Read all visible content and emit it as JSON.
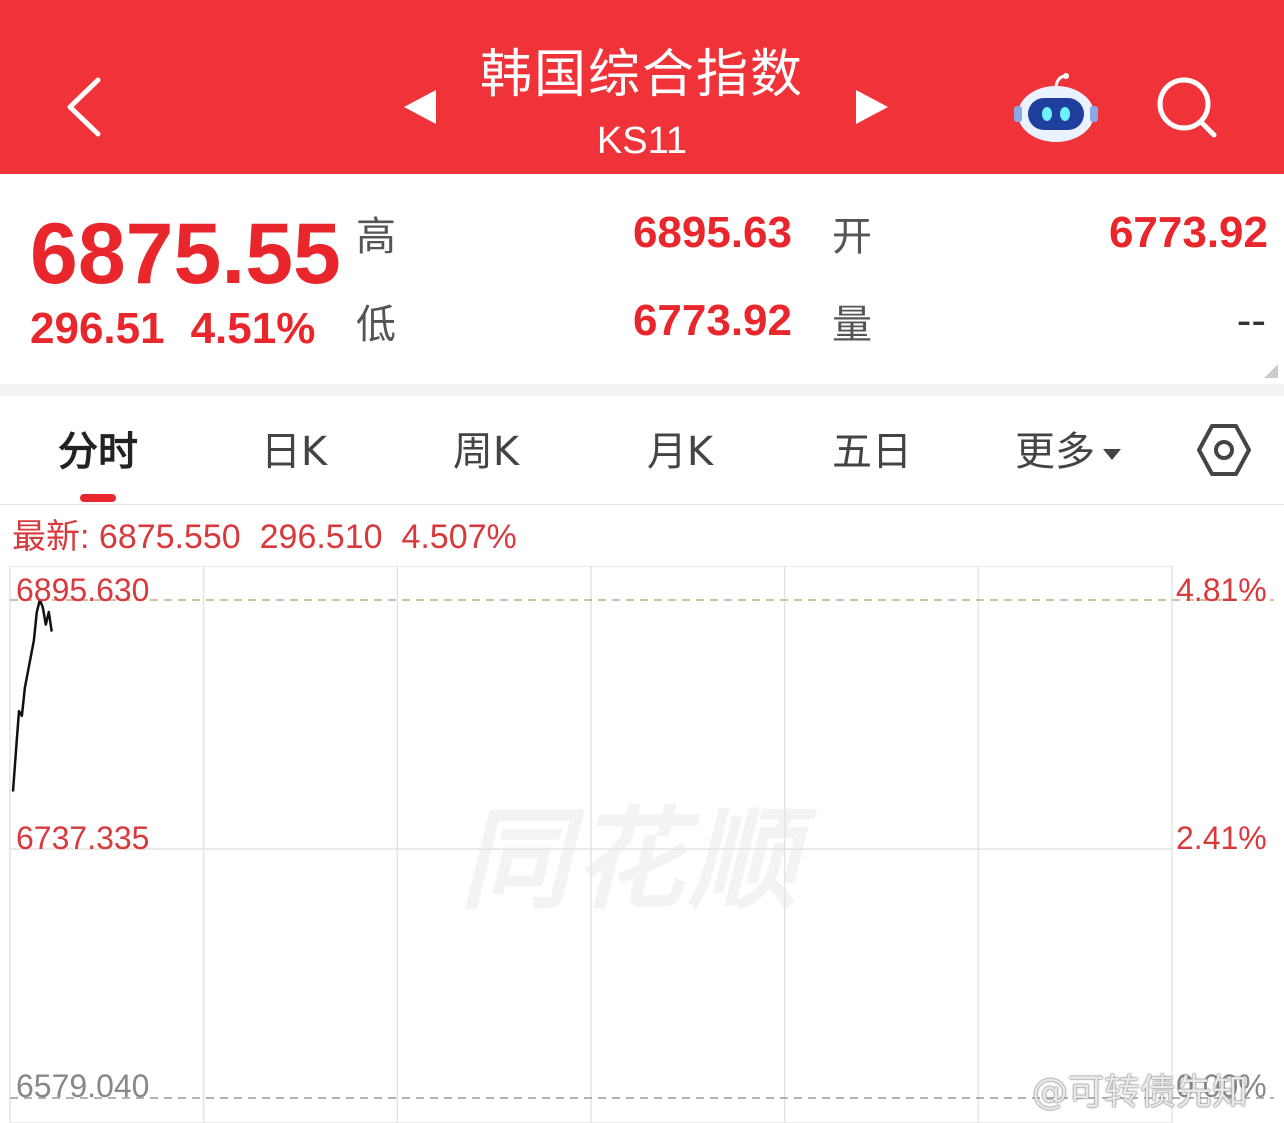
{
  "header": {
    "title": "韩国综合指数",
    "code": "KS11",
    "icons": [
      "back-icon",
      "prev-arrow-icon",
      "next-arrow-icon",
      "robot-icon",
      "search-icon"
    ]
  },
  "quote": {
    "price": "6875.55",
    "change": "296.51",
    "change_pct": "4.51%",
    "high_label": "高",
    "high_value": "6895.63",
    "open_label": "开",
    "open_value": "6773.92",
    "low_label": "低",
    "low_value": "6773.92",
    "volume_label": "量",
    "volume_value": "--"
  },
  "tabs": [
    {
      "label": "分时",
      "active": true
    },
    {
      "label": "日K"
    },
    {
      "label": "周K"
    },
    {
      "label": "月K"
    },
    {
      "label": "五日"
    },
    {
      "label": "更多"
    }
  ],
  "info_line": {
    "label": "最新:",
    "price": "6875.550",
    "change": "296.510",
    "pct": "4.507%"
  },
  "chart_data": {
    "type": "line",
    "y_left_ticks": [
      "6895.630",
      "6737.335",
      "6579.040"
    ],
    "y_right_ticks": [
      "4.81%",
      "2.41%",
      "0.00%"
    ],
    "ylim": [
      6579.04,
      6895.63
    ],
    "x": [
      0,
      1,
      2,
      3,
      4,
      5,
      6,
      7,
      8,
      9,
      10,
      11,
      12,
      13
    ],
    "series": [
      {
        "values": [
          6773.9,
          6800,
          6825,
          6822,
          6840,
          6850,
          6860,
          6870,
          6888,
          6895.6,
          6891,
          6880,
          6888,
          6875.55
        ]
      }
    ],
    "x_points_total": 390,
    "colors": {
      "line": "#111111",
      "grid": "#e4e4e4",
      "ref_dash": "#d0d0d0"
    }
  },
  "watermark": "同花顺",
  "credit": "@可转债先知",
  "colors": {
    "brand_red": "#ef3339",
    "up_red": "#e8262b"
  }
}
